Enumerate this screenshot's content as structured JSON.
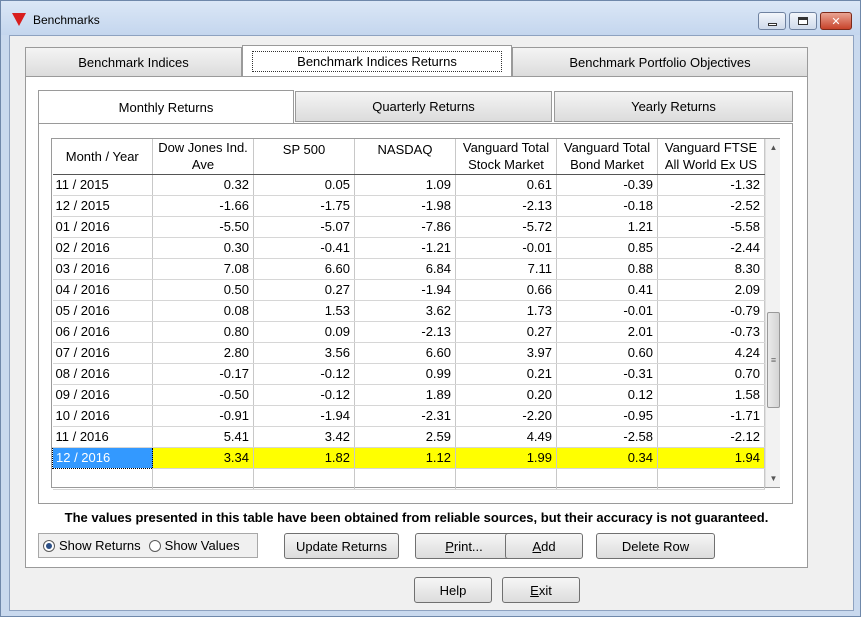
{
  "window": {
    "title": "Benchmarks",
    "minimize_icon": "minimize-icon",
    "maximize_icon": "maximize-icon",
    "close_icon": "close-icon",
    "close_glyph": "✕",
    "app_icon": "red-triangle-icon"
  },
  "outer_tabs": [
    {
      "label": "Benchmark Indices",
      "active": false
    },
    {
      "label": "Benchmark Indices Returns",
      "active": true
    },
    {
      "label": "Benchmark Portfolio Objectives",
      "active": false
    }
  ],
  "inner_tabs": [
    {
      "label": "Monthly Returns",
      "active": true
    },
    {
      "label": "Quarterly Returns",
      "active": false
    },
    {
      "label": "Yearly Returns",
      "active": false
    }
  ],
  "grid": {
    "columns": [
      {
        "line1": "Month / Year",
        "line2": ""
      },
      {
        "line1": "Dow Jones Ind.",
        "line2": "Ave"
      },
      {
        "line1": "SP 500",
        "line2": ""
      },
      {
        "line1": "NASDAQ",
        "line2": ""
      },
      {
        "line1": "Vanguard Total",
        "line2": "Stock Market"
      },
      {
        "line1": "Vanguard Total",
        "line2": "Bond Market"
      },
      {
        "line1": "Vanguard FTSE",
        "line2": "All World Ex US"
      }
    ],
    "rows": [
      [
        "11 / 2015",
        "0.32",
        "0.05",
        "1.09",
        "0.61",
        "-0.39",
        "-1.32"
      ],
      [
        "12 / 2015",
        "-1.66",
        "-1.75",
        "-1.98",
        "-2.13",
        "-0.18",
        "-2.52"
      ],
      [
        "01 / 2016",
        "-5.50",
        "-5.07",
        "-7.86",
        "-5.72",
        "1.21",
        "-5.58"
      ],
      [
        "02 / 2016",
        "0.30",
        "-0.41",
        "-1.21",
        "-0.01",
        "0.85",
        "-2.44"
      ],
      [
        "03 / 2016",
        "7.08",
        "6.60",
        "6.84",
        "7.11",
        "0.88",
        "8.30"
      ],
      [
        "04 / 2016",
        "0.50",
        "0.27",
        "-1.94",
        "0.66",
        "0.41",
        "2.09"
      ],
      [
        "05 / 2016",
        "0.08",
        "1.53",
        "3.62",
        "1.73",
        "-0.01",
        "-0.79"
      ],
      [
        "06 / 2016",
        "0.80",
        "0.09",
        "-2.13",
        "0.27",
        "2.01",
        "-0.73"
      ],
      [
        "07 / 2016",
        "2.80",
        "3.56",
        "6.60",
        "3.97",
        "0.60",
        "4.24"
      ],
      [
        "08 / 2016",
        "-0.17",
        "-0.12",
        "0.99",
        "0.21",
        "-0.31",
        "0.70"
      ],
      [
        "09 / 2016",
        "-0.50",
        "-0.12",
        "1.89",
        "0.20",
        "0.12",
        "1.58"
      ],
      [
        "10 / 2016",
        "-0.91",
        "-1.94",
        "-2.31",
        "-2.20",
        "-0.95",
        "-1.71"
      ],
      [
        "11 / 2016",
        "5.41",
        "3.42",
        "2.59",
        "4.49",
        "-2.58",
        "-2.12"
      ],
      [
        "12 / 2016",
        "3.34",
        "1.82",
        "1.12",
        "1.99",
        "0.34",
        "1.94"
      ]
    ],
    "selected_row": "12 / 2016",
    "highlight_color": "#ffff00",
    "selection_color": "#3399ff",
    "scroll_up_icon": "scroll-up-arrow-icon",
    "scroll_down_icon": "scroll-down-arrow-icon",
    "scroll_up_glyph": "▲",
    "scroll_down_glyph": "▼",
    "scroll_thumb_glyph": "≡"
  },
  "disclaimer": "The values presented in this table have been obtained from reliable sources, but their accuracy is not guaranteed.",
  "view_options": [
    {
      "label": "Show Returns",
      "selected": true
    },
    {
      "label": "Show Values",
      "selected": false
    }
  ],
  "buttons": {
    "update_returns": "Update Returns",
    "print_prefix": "",
    "print_mnemonic": "P",
    "print_rest": "rint...",
    "add_mnemonic": "A",
    "add_rest": "dd",
    "delete_row": "Delete Row",
    "help": "Help",
    "exit_mnemonic": "E",
    "exit_rest": "xit"
  }
}
